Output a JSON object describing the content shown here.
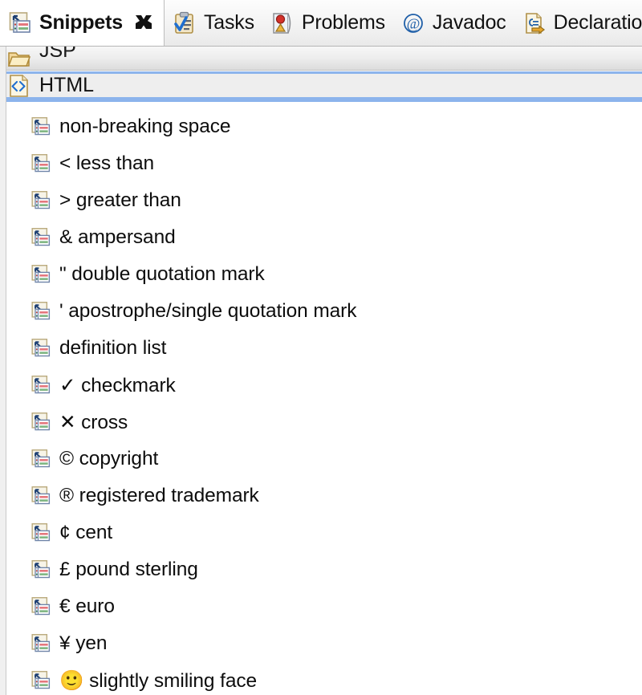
{
  "window": {
    "view_title": "Snippets"
  },
  "tabs": [
    {
      "label": "Snippets",
      "icon": "snippets-icon",
      "active": true,
      "closable": true
    },
    {
      "label": "Tasks",
      "icon": "tasks-icon",
      "active": false,
      "closable": false
    },
    {
      "label": "Problems",
      "icon": "problems-icon",
      "active": false,
      "closable": false
    },
    {
      "label": "Javadoc",
      "icon": "javadoc-at-icon",
      "active": false,
      "closable": false
    },
    {
      "label": "Declaration",
      "icon": "declaration-icon",
      "active": false,
      "closable": false
    }
  ],
  "tab_close_glyph": "maximize-x-icon",
  "categories": [
    {
      "label": "JSP",
      "icon": "folder-icon",
      "expanded": false,
      "selected": false
    },
    {
      "label": "HTML",
      "icon": "html-document-icon",
      "expanded": true,
      "selected": true
    }
  ],
  "snippets": [
    {
      "label": "non-breaking space",
      "icon": "snippet-item-icon"
    },
    {
      "label": "< less than",
      "icon": "snippet-item-icon"
    },
    {
      "label": "> greater than",
      "icon": "snippet-item-icon"
    },
    {
      "label": "& ampersand",
      "icon": "snippet-item-icon"
    },
    {
      "label": "\" double quotation mark",
      "icon": "snippet-item-icon"
    },
    {
      "label": "' apostrophe/single quotation mark",
      "icon": "snippet-item-icon"
    },
    {
      "label": "definition list",
      "icon": "snippet-item-icon"
    },
    {
      "label": "✓ checkmark",
      "icon": "snippet-item-icon"
    },
    {
      "label": "✕ cross",
      "icon": "snippet-item-icon"
    },
    {
      "label": "© copyright",
      "icon": "snippet-item-icon"
    },
    {
      "label": "® registered trademark",
      "icon": "snippet-item-icon"
    },
    {
      "label": "¢ cent",
      "icon": "snippet-item-icon"
    },
    {
      "label": "£ pound sterling",
      "icon": "snippet-item-icon"
    },
    {
      "label": "€ euro",
      "icon": "snippet-item-icon"
    },
    {
      "label": "¥ yen",
      "icon": "snippet-item-icon"
    },
    {
      "label": "🙂 slightly smiling face",
      "icon": "snippet-item-icon"
    }
  ],
  "colors": {
    "selection_border": "#8cb4ec",
    "selection_fill": "#eeeeee",
    "tab_active_bg": "#ffffff",
    "tabbar_bg": "#f3f3f3",
    "body_bg": "#ffffff",
    "text": "#111111",
    "folder_icon": "#d9a441",
    "problem_marker": "#cc2222"
  }
}
